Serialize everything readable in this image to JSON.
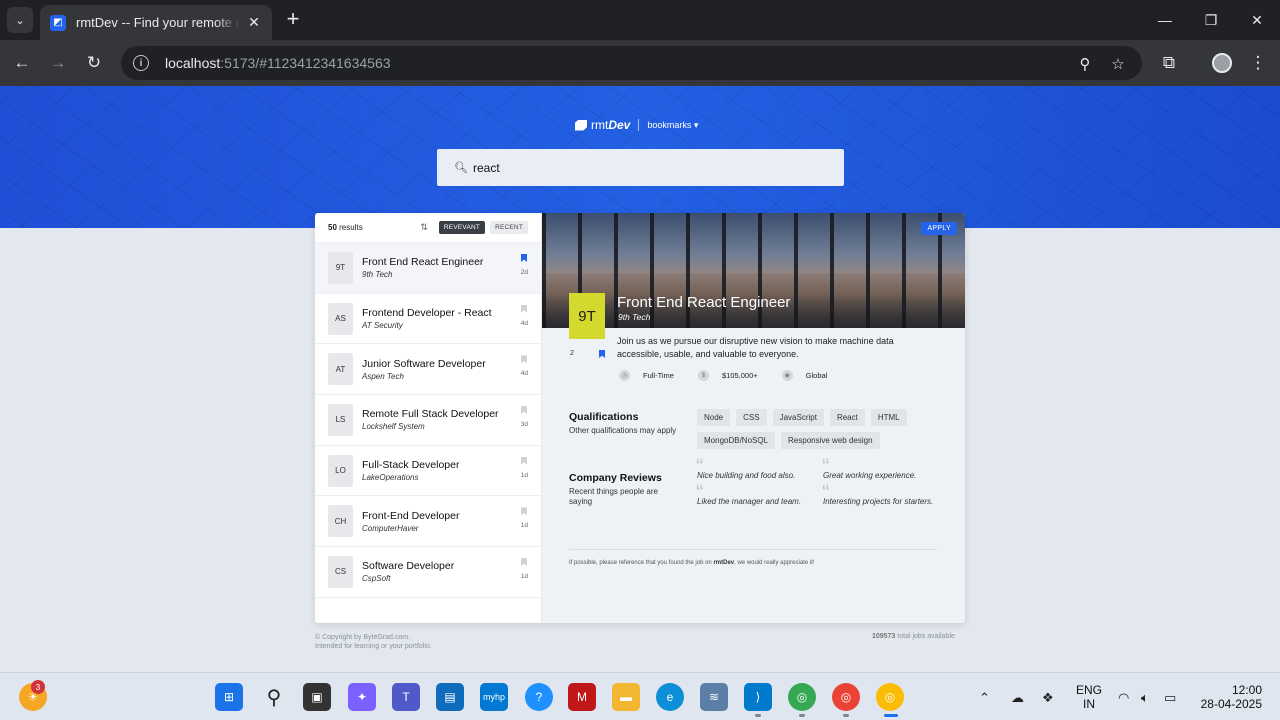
{
  "browser": {
    "tab_title": "rmtDev -- Find your remote dev",
    "url_host": "localhost",
    "url_path": ":5173/#1123412341634563"
  },
  "header": {
    "brand_rmt": "rmt",
    "brand_dev": "Dev",
    "bookmarks_label": "bookmarks ▾",
    "search_value": "react"
  },
  "sidebar": {
    "results_count": "50",
    "results_label": " results",
    "sort_relevant": "REVEVANT",
    "sort_recent": "RECENT",
    "jobs": [
      {
        "badge": "9T",
        "title": "Front End React Engineer",
        "company": "9th Tech",
        "days": "2d",
        "bookmarked": true
      },
      {
        "badge": "AS",
        "title": "Frontend Developer - React",
        "company": "AT Security",
        "days": "4d",
        "bookmarked": false
      },
      {
        "badge": "AT",
        "title": "Junior Software Developer",
        "company": "Aspen Tech",
        "days": "4d",
        "bookmarked": false
      },
      {
        "badge": "LS",
        "title": "Remote Full Stack Developer",
        "company": "Lockshelf System",
        "days": "3d",
        "bookmarked": false
      },
      {
        "badge": "LO",
        "title": "Full-Stack Developer",
        "company": "LakeOperations",
        "days": "1d",
        "bookmarked": false
      },
      {
        "badge": "CH",
        "title": "Front-End Developer",
        "company": "ComputerHaver",
        "days": "1d",
        "bookmarked": false
      },
      {
        "badge": "CS",
        "title": "Software Developer",
        "company": "CspSoft",
        "days": "1d",
        "bookmarked": false
      }
    ]
  },
  "detail": {
    "apply_label": "APPLY",
    "badge": "9T",
    "title": "Front End React Engineer",
    "company": "9th Tech",
    "rank": "2",
    "description": "Join us as we pursue our disruptive new vision to make machine data accessible, usable, and valuable to everyone.",
    "employment": "Full-Time",
    "salary": "$105,000+",
    "location": "Global",
    "qualifications_title": "Qualifications",
    "qualifications_sub": "Other qualifications may apply",
    "qualifications": [
      "Node",
      "CSS",
      "JavaScript",
      "React",
      "HTML",
      "MongoDB/NoSQL",
      "Responsive web design"
    ],
    "reviews_title": "Company Reviews",
    "reviews_sub": "Recent things people are saying",
    "reviews": [
      "Nice building and food also.",
      "Great working experience.",
      "Liked the manager and team.",
      "Interesting projects for starters."
    ],
    "footer_pre": "If possible, please reference that you found the job on ",
    "footer_brand": "rmtDev",
    "footer_post": ", we would really appreciate it!"
  },
  "page_footer": {
    "copyright": "© Copyright by ByteGrad.com.",
    "intended": "Intended for learning or your portfolio.",
    "total_count": "109573",
    "total_label": " total jobs available"
  },
  "taskbar": {
    "notification_count": "3",
    "lang_top": "ENG",
    "lang_bottom": "IN",
    "time": "12:00",
    "date": "28-04-2025"
  },
  "colors": {
    "accent": "#2563eb",
    "hero": "#2360e3",
    "badge_yellow": "#d4d92e"
  }
}
